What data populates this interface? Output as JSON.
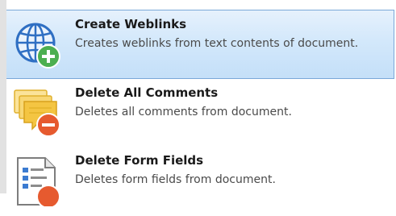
{
  "menu": {
    "items": [
      {
        "title": "Create Weblinks",
        "description": "Creates weblinks from text contents of document.",
        "icon": "globe-add-icon",
        "selected": true
      },
      {
        "title": "Delete All Comments",
        "description": "Deletes all comments from document.",
        "icon": "comments-delete-icon",
        "selected": false
      },
      {
        "title": "Delete Form Fields",
        "description": "Deletes form fields from document.",
        "icon": "form-fields-delete-icon",
        "selected": false
      }
    ]
  },
  "colors": {
    "selection_fill": "#d3e8fb",
    "selection_border": "#7aa8d9",
    "globe_blue": "#2f6fc3",
    "add_green": "#4caf50",
    "delete_red": "#e65a2f",
    "comment_yellow": "#f4c542"
  }
}
